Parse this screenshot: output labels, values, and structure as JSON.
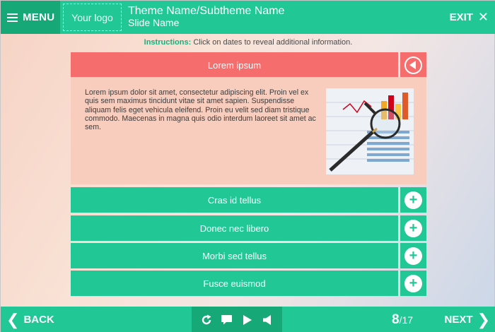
{
  "header": {
    "menu_label": "MENU",
    "logo_text": "Your logo",
    "title": "Theme Name/Subtheme Name",
    "subtitle": "Slide Name",
    "exit_label": "EXIT"
  },
  "instructions": {
    "label": "Instructions:",
    "text": "Click on dates to reveal additional information."
  },
  "accordion": {
    "items": [
      {
        "label": "Lorem ipsum",
        "state": "open",
        "body": "Lorem ipsum dolor sit amet, consectetur adipiscing elit. Proin vel ex quis sem maximus tincidunt vitae sit amet sapien. Suspendisse aliquam felis eget vehicula eleifend. Proin eu velit sed diam tristique commodo. Maecenas in magna quis odio interdum laoreet sit amet ac sem."
      },
      {
        "label": "Cras id tellus",
        "state": "closed"
      },
      {
        "label": "Donec nec libero",
        "state": "closed"
      },
      {
        "label": "Morbi sed tellus",
        "state": "closed"
      },
      {
        "label": "Fusce euismod",
        "state": "closed"
      }
    ]
  },
  "footer": {
    "back_label": "BACK",
    "next_label": "NEXT",
    "page_current": "8",
    "page_total": "/17"
  },
  "icons": {
    "menu": "hamburger-icon",
    "exit": "close-icon",
    "open_item": "collapse-arrow-icon",
    "closed_item": "plus-icon",
    "controls": [
      "replay-icon",
      "subtitles-icon",
      "play-icon",
      "volume-icon"
    ]
  },
  "colors": {
    "primary": "#21c896",
    "primary_dark": "#17a878",
    "accent_open": "#f56d6d",
    "panel_bg": "#f9cdbd"
  }
}
